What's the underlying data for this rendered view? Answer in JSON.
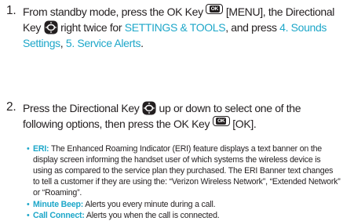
{
  "steps": [
    {
      "number": "1.",
      "line1_a": "From standby mode, press the OK Key",
      "line1_b": "[MENU], the Directional",
      "line2_a": "Key",
      "line2_b": "right twice for",
      "settings_link": "SETTINGS & TOOLS",
      "line2_c": ", and press",
      "sounds_link_1": "4. Sounds",
      "sounds_link_2": "Settings",
      "comma": ",",
      "alerts_link": "5. Service Alerts",
      "period": "."
    },
    {
      "number": "2.",
      "line1_a": "Press the Directional Key",
      "line1_b": "up or down to select one of the",
      "line2_a": "following options, then press the OK Key",
      "line2_b": "[OK]."
    }
  ],
  "keys": {
    "ok_label": "OK"
  },
  "options": [
    {
      "term": "ERI:",
      "text": "The Enhanced Roaming Indicator (ERI) feature displays a text banner on the display screen informing the handset user of which systems the wireless device is using as compared to the service plan they purchased. The ERI Banner text changes to tell a customer if they are using the: “Verizon Wireless Network”, “Extended Network” or “Roaming”."
    },
    {
      "term": "Minute Beep:",
      "text": "Alerts you every minute during a call."
    },
    {
      "term": "Call Connect:",
      "text": "Alerts you when the call is connected."
    }
  ],
  "colors": {
    "accent": "#1ea7c9",
    "text": "#231f20"
  },
  "icons": [
    "ok-key-icon",
    "directional-key-icon"
  ]
}
